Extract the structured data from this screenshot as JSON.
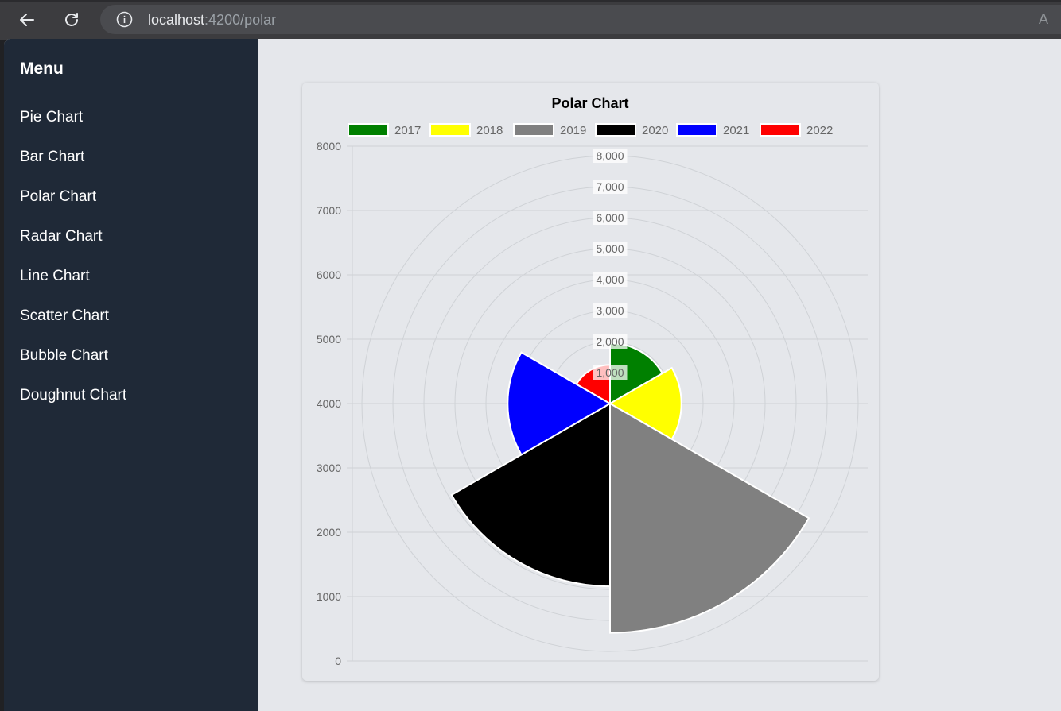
{
  "browser": {
    "url_host": "localhost",
    "url_path": ":4200/polar",
    "omnibox_right": "A"
  },
  "sidebar": {
    "title": "Menu",
    "items": [
      {
        "label": "Pie Chart"
      },
      {
        "label": "Bar Chart"
      },
      {
        "label": "Polar Chart"
      },
      {
        "label": "Radar Chart"
      },
      {
        "label": "Line Chart"
      },
      {
        "label": "Scatter Chart"
      },
      {
        "label": "Bubble Chart"
      },
      {
        "label": "Doughnut Chart"
      }
    ]
  },
  "chart_data": {
    "type": "polarArea",
    "title": "Polar Chart",
    "categories": [
      "2017",
      "2018",
      "2019",
      "2020",
      "2021",
      "2022"
    ],
    "values": [
      1950,
      2300,
      7400,
      5900,
      3300,
      1250
    ],
    "colors": [
      "#008000",
      "#ffff00",
      "#808080",
      "#000000",
      "#0000ff",
      "#ff0000"
    ],
    "legend_position": "top",
    "radial_ticks": [
      "1,000",
      "2,000",
      "3,000",
      "4,000",
      "5,000",
      "6,000",
      "7,000",
      "8,000"
    ],
    "radial_max": 8000,
    "y_ticks": [
      "0",
      "1000",
      "2000",
      "3000",
      "4000",
      "5000",
      "6000",
      "7000",
      "8000"
    ],
    "ylim": [
      0,
      8000
    ],
    "grid": true
  }
}
